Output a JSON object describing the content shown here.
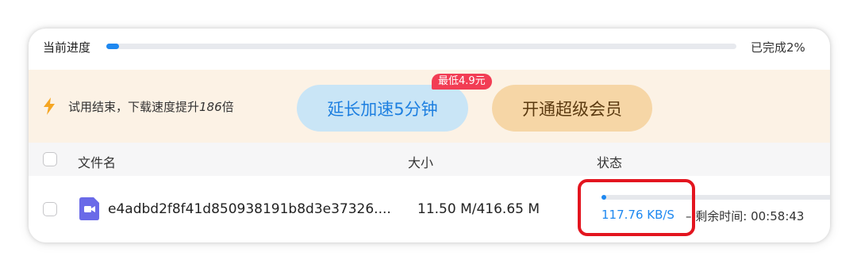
{
  "progress": {
    "label": "当前进度",
    "percent": 2,
    "status_text": "已完成2%",
    "colors": {
      "fill": "#1e88f0",
      "track": "#e7e9ee"
    }
  },
  "promo": {
    "icon": "lightning-bolt-icon",
    "text_prefix": "试用结束，下载速度提升",
    "text_number": "186",
    "text_suffix": "倍",
    "extend_button": "延长加速5分钟",
    "badge": "最低4.9元",
    "vip_button": "开通超级会员",
    "colors": {
      "background": "#fcf2e5",
      "extend_bg": "#c9e5f6",
      "vip_bg": "#f6d6a6",
      "badge_bg": "#f23d54"
    }
  },
  "table": {
    "headers": {
      "name": "文件名",
      "size": "大小",
      "status": "状态"
    },
    "rows": [
      {
        "icon": "video-file-icon",
        "name": "e4adbd2f8f41d850938191b8d3e37326....",
        "size": "11.50 M/416.65 M",
        "progress_percent": 2,
        "speed": "117.76 KB/S",
        "remaining": "– 剩余时间: 00:58:43"
      }
    ]
  },
  "annotation": {
    "color": "#e3151f"
  }
}
